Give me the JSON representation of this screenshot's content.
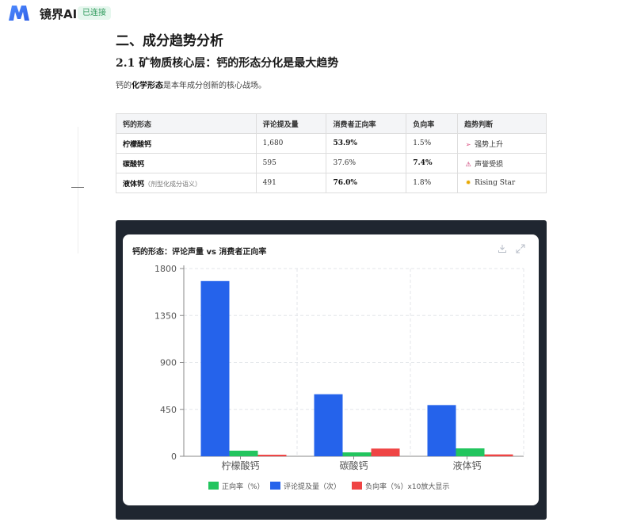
{
  "app": {
    "name": "镜界AI",
    "status": "已连接",
    "brand_color": "#3b6cf6"
  },
  "content": {
    "section_title": "二、成分趋势分析",
    "subsection_title": "2.1 矿物质核心层：钙的形态分化是最大趋势",
    "intro_prefix": "钙的",
    "intro_bold": "化学形态",
    "intro_suffix": "是本年成分创新的核心战场。"
  },
  "table": {
    "headers": [
      "钙的形态",
      "评论提及量",
      "消费者正向率",
      "负向率",
      "趋势判断"
    ],
    "rows": [
      {
        "form": "柠檬酸钙",
        "note": "",
        "mentions": "1,680",
        "positive": "53.9%",
        "negative": "1.5%",
        "trend_icon": "rocket-icon",
        "trend": "强势上升"
      },
      {
        "form": "碳酸钙",
        "note": "",
        "mentions": "595",
        "positive": "37.6%",
        "negative": "7.4%",
        "trend_icon": "warning-icon",
        "trend": "声誉受损"
      },
      {
        "form": "液体钙",
        "note": "（剂型化成分语义）",
        "mentions": "491",
        "positive": "76.0%",
        "negative": "1.8%",
        "trend_icon": "star-icon",
        "trend": "Rising Star"
      }
    ]
  },
  "chart_data": {
    "type": "bar",
    "title": "钙的形态：评论声量 vs 消费者正向率",
    "categories": [
      "柠檬酸钙",
      "碳酸钙",
      "液体钙"
    ],
    "ylim": [
      0,
      1800
    ],
    "yticks": [
      "0",
      "450",
      "900",
      "1350",
      "1800"
    ],
    "ytick_values": [
      0,
      450,
      900,
      1350,
      1800
    ],
    "grid": true,
    "legend_position": "bottom",
    "series": [
      {
        "name": "评论提及量（次）",
        "values": [
          1680,
          595,
          491
        ],
        "color": "#2563eb"
      },
      {
        "name": "正向率（%）",
        "values": [
          53.9,
          37.6,
          76.0
        ],
        "color": "#22c55e"
      },
      {
        "name": "负向率（%）x10放大显示",
        "values": [
          15,
          74,
          18
        ],
        "color": "#ef4444"
      }
    ],
    "legend": [
      "正向率（%）",
      "评论提及量（次）",
      "负向率（%）x10放大显示"
    ],
    "legend_colors": [
      "#22c55e",
      "#2563eb",
      "#ef4444"
    ]
  }
}
